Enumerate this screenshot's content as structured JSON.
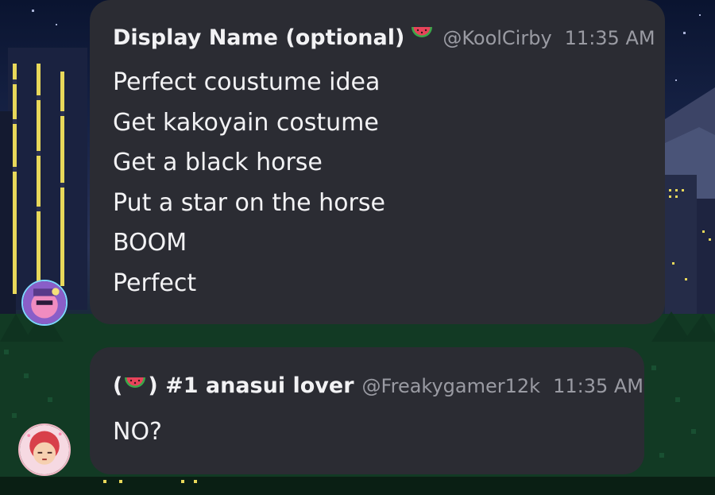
{
  "messages": [
    {
      "display_name": "Display Name (optional)",
      "name_prefix": "",
      "name_suffix": "",
      "emoji_icon": "watermelon-icon",
      "handle": "@KoolCirby",
      "time": "11:35 AM",
      "lines": [
        "Perfect coustume idea",
        "Get kakoyain costume",
        "Get a black horse",
        "Put a star on the horse",
        "BOOM",
        "Perfect"
      ]
    },
    {
      "name_prefix": "(",
      "emoji_icon": "watermelon-icon",
      "name_suffix": ") #1 anasui lover",
      "handle": "@Freakygamer12k",
      "time": "11:35 AM",
      "lines": [
        "NO?"
      ]
    }
  ],
  "colors": {
    "bubble": "#2b2c33",
    "name_text": "#f2f2f4",
    "meta_text": "#9a9ba3",
    "avatar1_ring": "#7fd6ff",
    "avatar2_ring": "#f2b8c6"
  }
}
